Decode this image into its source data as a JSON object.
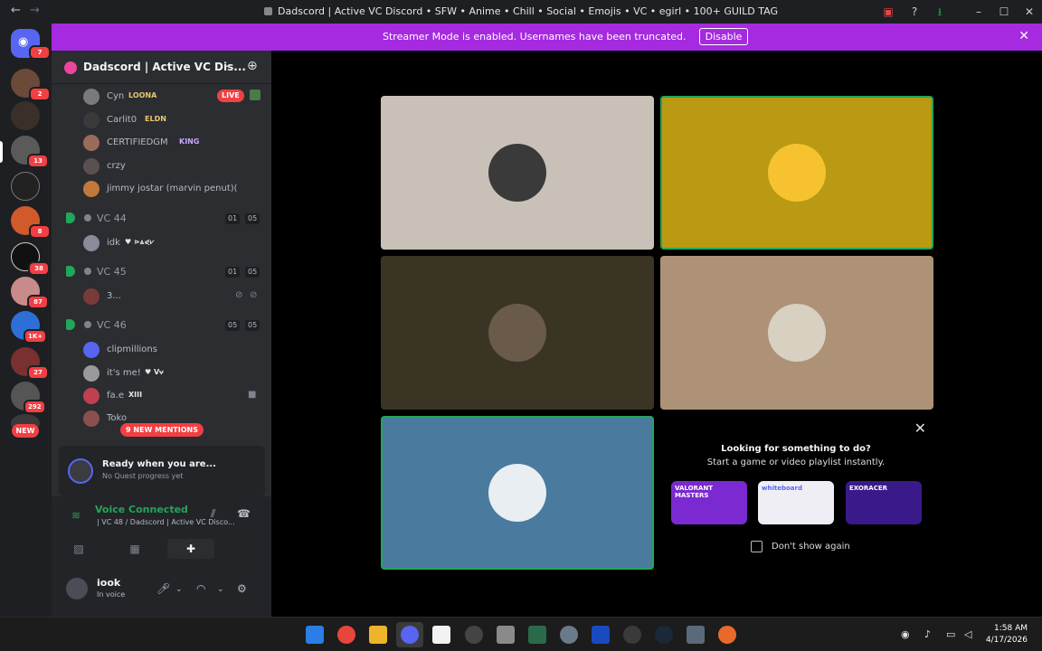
{
  "window": {
    "title": "Dadscord | Active VC Discord • SFW • Anime • Chill • Social • Emojis • VC • egirl • 100+ GUILD TAG"
  },
  "banner": {
    "message": "Streamer Mode is enabled. Usernames have been truncated.",
    "button": "Disable"
  },
  "rail": {
    "home_badge": "7",
    "servers": [
      {
        "badge": "2"
      },
      {
        "badge": ""
      },
      {
        "badge": "13"
      },
      {
        "badge": ""
      },
      {
        "badge": "8"
      },
      {
        "badge": "38"
      },
      {
        "badge": "87"
      },
      {
        "badge": "1K+"
      },
      {
        "badge": "27"
      },
      {
        "badge": "292"
      }
    ],
    "new_label": "NEW"
  },
  "server": {
    "name": "Dadscord | Active VC Dis..."
  },
  "members_top": [
    {
      "name": "Cyn",
      "tag": "LOONA",
      "live": "LIVE"
    },
    {
      "name": "Carlit0",
      "tag": "ELDN"
    },
    {
      "name": "CERTIFIEDGM",
      "tag": "KING"
    },
    {
      "name": "crzy",
      "tag": ""
    },
    {
      "name": "jimmy jostar (marvin penut)(",
      "tag": ""
    }
  ],
  "voice_channels": [
    {
      "name": "VC 44",
      "count_a": "01",
      "count_b": "05",
      "members": [
        {
          "name": "idk",
          "tag": "♥ ⋗⩓⋞⩗"
        }
      ]
    },
    {
      "name": "VC 45",
      "count_a": "01",
      "count_b": "05",
      "members": [
        {
          "name": "3...",
          "tag": ""
        }
      ]
    },
    {
      "name": "VC 46",
      "count_a": "05",
      "count_b": "05",
      "members": [
        {
          "name": "clipmillions",
          "tag": ""
        },
        {
          "name": "it's me!",
          "tag": "♥ V⩝"
        },
        {
          "name": "fa.e",
          "tag": "XIII"
        },
        {
          "name": "Toko",
          "tag": ""
        }
      ]
    }
  ],
  "mentions": "9 NEW MENTIONS",
  "quest": {
    "title": "Ready when you are...",
    "subtitle": "No Quest progress yet"
  },
  "voice": {
    "status": "Voice Connected",
    "detail": "| VC 48 / Dadscord | Active VC Disco..."
  },
  "user": {
    "name": "iook",
    "status": "In voice"
  },
  "activity": {
    "heading": "Looking for something to do?",
    "subheading": "Start a game or video playlist instantly.",
    "cards": [
      "VALORANT MASTERS",
      "whiteboard",
      "EXORACER"
    ],
    "checkbox_label": "Don't show again"
  },
  "colors": {
    "brand": "#5865f2",
    "banner": "#a52ae0",
    "speaking": "#23a55a",
    "live": "#ed4245"
  },
  "clock": {
    "time": "1:58 AM",
    "date": "4/17/2026"
  }
}
